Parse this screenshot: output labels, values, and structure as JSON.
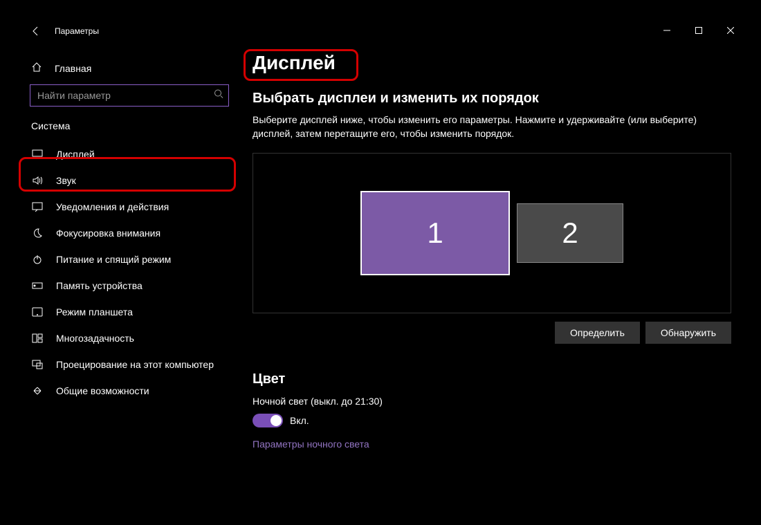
{
  "header": {
    "title": "Параметры"
  },
  "sidebar": {
    "home": "Главная",
    "search_placeholder": "Найти параметр",
    "section": "Система",
    "items": [
      {
        "label": "Дисплей"
      },
      {
        "label": "Звук"
      },
      {
        "label": "Уведомления и действия"
      },
      {
        "label": "Фокусировка внимания"
      },
      {
        "label": "Питание и спящий режим"
      },
      {
        "label": "Память устройства"
      },
      {
        "label": "Режим планшета"
      },
      {
        "label": "Многозадачность"
      },
      {
        "label": "Проецирование на этот компьютер"
      },
      {
        "label": "Общие возможности"
      }
    ]
  },
  "main": {
    "title": "Дисплей",
    "rearrange_heading": "Выбрать дисплеи и изменить их порядок",
    "rearrange_desc": "Выберите дисплей ниже, чтобы изменить его параметры. Нажмите и удерживайте (или выберите) дисплей, затем перетащите его, чтобы изменить порядок.",
    "monitors": [
      "1",
      "2"
    ],
    "identify": "Определить",
    "detect": "Обнаружить",
    "color_heading": "Цвет",
    "night_light_label": "Ночной свет (выкл. до 21:30)",
    "toggle_on_label": "Вкл.",
    "night_light_settings": "Параметры ночного света"
  }
}
